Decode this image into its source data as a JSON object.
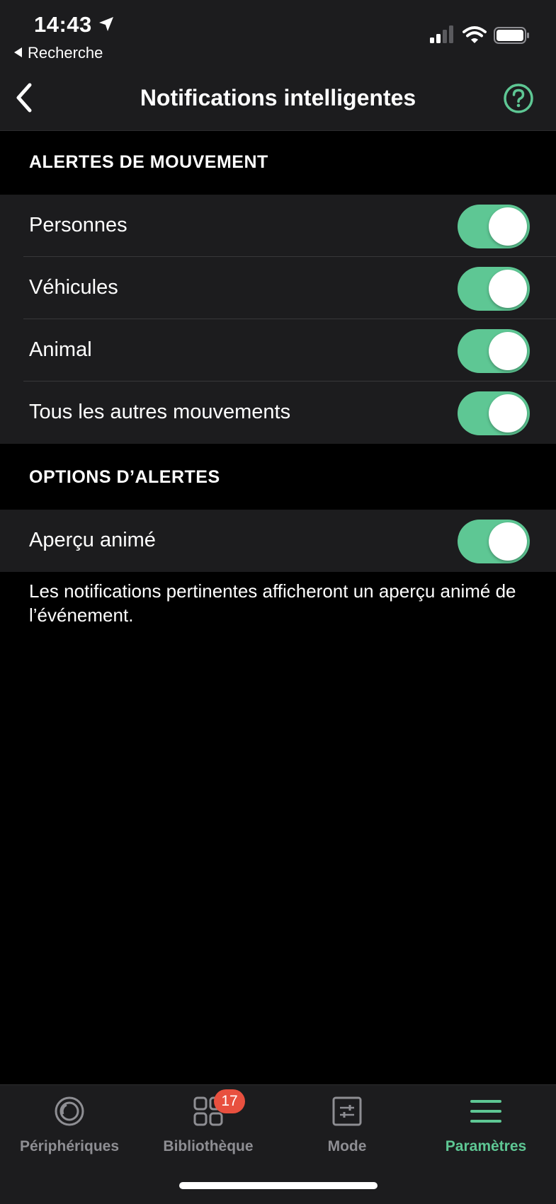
{
  "status_bar": {
    "time": "14:43",
    "back_app_label": "Recherche"
  },
  "nav": {
    "title": "Notifications intelligentes"
  },
  "colors": {
    "accent": "#5ec794",
    "badge": "#e8503f",
    "background": "#000000",
    "surface": "#1c1c1e"
  },
  "sections": {
    "motion": {
      "header": "ALERTES DE MOUVEMENT",
      "items": [
        {
          "label": "Personnes",
          "enabled": true
        },
        {
          "label": "Véhicules",
          "enabled": true
        },
        {
          "label": "Animal",
          "enabled": true
        },
        {
          "label": "Tous les autres mouvements",
          "enabled": true
        }
      ]
    },
    "options": {
      "header": "OPTIONS D’ALERTES",
      "items": [
        {
          "label": "Aperçu animé",
          "enabled": true
        }
      ],
      "footer": "Les notifications pertinentes afficheront un aperçu animé de l’événement."
    }
  },
  "tab_bar": {
    "tabs": [
      {
        "label": "Périphériques",
        "icon": "devices-icon",
        "active": false
      },
      {
        "label": "Bibliothèque",
        "icon": "library-grid-icon",
        "active": false,
        "badge": "17"
      },
      {
        "label": "Mode",
        "icon": "mode-sliders-icon",
        "active": false
      },
      {
        "label": "Paramètres",
        "icon": "settings-menu-icon",
        "active": true
      }
    ]
  }
}
